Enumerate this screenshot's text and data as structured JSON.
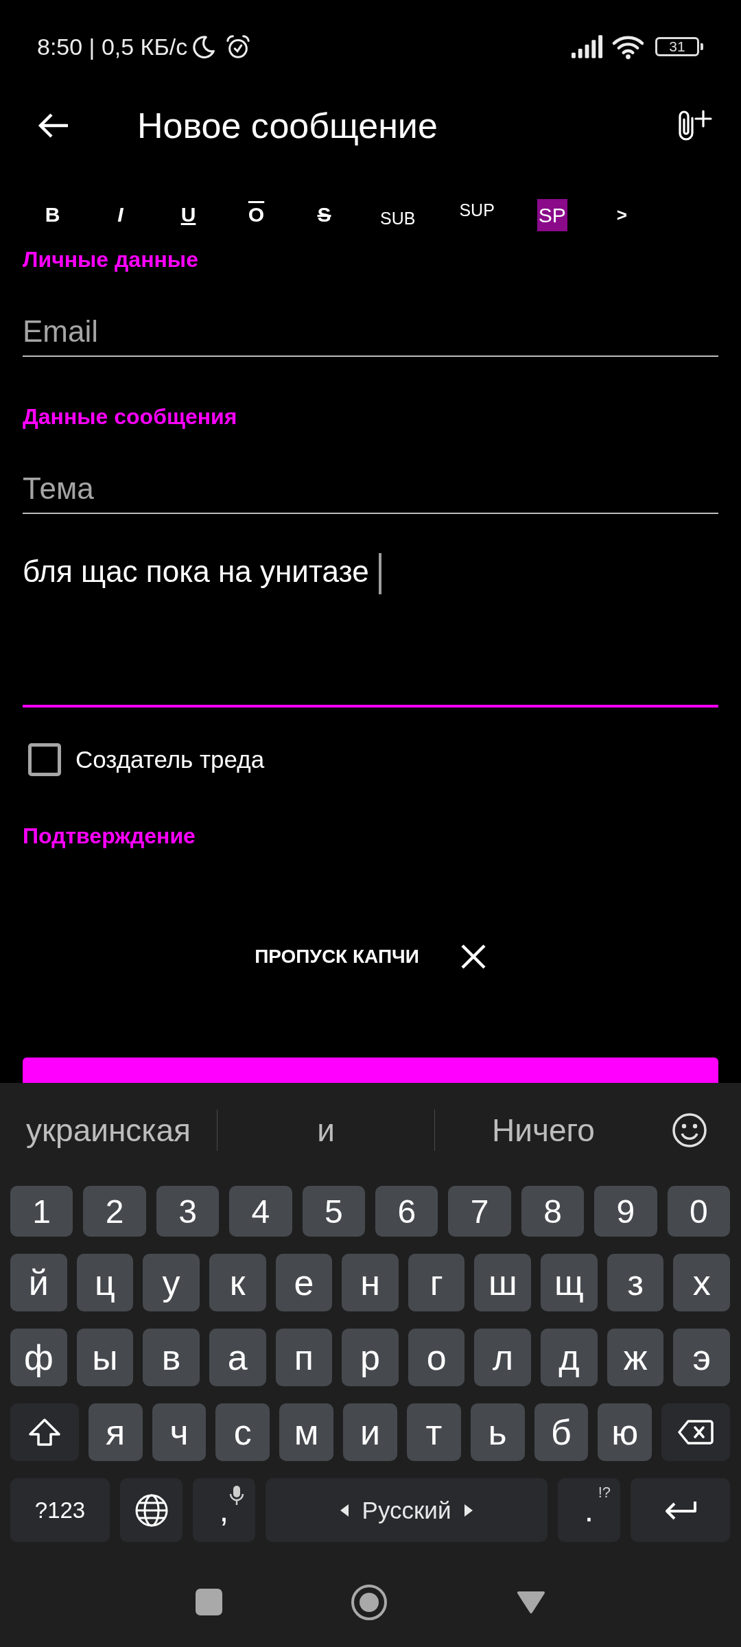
{
  "status_bar": {
    "text": "8:50 | 0,5 КБ/с",
    "battery": "31"
  },
  "header": {
    "title": "Новое сообщение"
  },
  "format_toolbar": [
    {
      "label": "B",
      "kind": "bold"
    },
    {
      "label": "I",
      "kind": "italic"
    },
    {
      "label": "U",
      "kind": "underline"
    },
    {
      "label": "O",
      "kind": "overline"
    },
    {
      "label": "S",
      "kind": "strike"
    },
    {
      "label": "SUB",
      "kind": "sub"
    },
    {
      "label": "SUP",
      "kind": "sup"
    },
    {
      "label": "SP",
      "kind": "spoiler"
    },
    {
      "label": ">",
      "kind": "more"
    }
  ],
  "sections": [
    {
      "title": "Личные данные",
      "fields": [
        {
          "kind": "line",
          "placeholder": "Email",
          "focused": false
        }
      ]
    },
    {
      "title": "Данные сообщения",
      "fields": [
        {
          "kind": "line",
          "placeholder": "Тема",
          "focused": false
        },
        {
          "kind": "multiline",
          "value": "бля щас пока на унитазе",
          "focused": true
        }
      ]
    }
  ],
  "thread_creator": {
    "label": "Создатель треда",
    "checked": false
  },
  "confirmation": {
    "title": "Подтверждение",
    "captcha_skip": "ПРОПУСК КАПЧИ"
  },
  "keyboard": {
    "suggestions": [
      "украинская",
      "и",
      "Ничего"
    ],
    "key_rows": [
      {
        "keys": [
          {
            "kind": "char",
            "label": "1"
          },
          {
            "kind": "char",
            "label": "2"
          },
          {
            "kind": "char",
            "label": "3"
          },
          {
            "kind": "char",
            "label": "4"
          },
          {
            "kind": "char",
            "label": "5"
          },
          {
            "kind": "char",
            "label": "6"
          },
          {
            "kind": "char",
            "label": "7"
          },
          {
            "kind": "char",
            "label": "8"
          },
          {
            "kind": "char",
            "label": "9"
          },
          {
            "kind": "char",
            "label": "0"
          }
        ]
      },
      {
        "keys": [
          {
            "kind": "char",
            "label": "й"
          },
          {
            "kind": "char",
            "label": "ц"
          },
          {
            "kind": "char",
            "label": "у"
          },
          {
            "kind": "char",
            "label": "к"
          },
          {
            "kind": "char",
            "label": "е"
          },
          {
            "kind": "char",
            "label": "н"
          },
          {
            "kind": "char",
            "label": "г"
          },
          {
            "kind": "char",
            "label": "ш"
          },
          {
            "kind": "char",
            "label": "щ"
          },
          {
            "kind": "char",
            "label": "з"
          },
          {
            "kind": "char",
            "label": "х"
          }
        ]
      },
      {
        "keys": [
          {
            "kind": "char",
            "label": "ф"
          },
          {
            "kind": "char",
            "label": "ы"
          },
          {
            "kind": "char",
            "label": "в"
          },
          {
            "kind": "char",
            "label": "а"
          },
          {
            "kind": "char",
            "label": "п"
          },
          {
            "kind": "char",
            "label": "р"
          },
          {
            "kind": "char",
            "label": "о"
          },
          {
            "kind": "char",
            "label": "л"
          },
          {
            "kind": "char",
            "label": "д"
          },
          {
            "kind": "char",
            "label": "ж"
          },
          {
            "kind": "char",
            "label": "э"
          }
        ]
      },
      {
        "keys": [
          {
            "kind": "shift"
          },
          {
            "kind": "char",
            "label": "я"
          },
          {
            "kind": "char",
            "label": "ч"
          },
          {
            "kind": "char",
            "label": "с"
          },
          {
            "kind": "char",
            "label": "м"
          },
          {
            "kind": "char",
            "label": "и"
          },
          {
            "kind": "char",
            "label": "т"
          },
          {
            "kind": "char",
            "label": "ь"
          },
          {
            "kind": "char",
            "label": "б"
          },
          {
            "kind": "char",
            "label": "ю"
          },
          {
            "kind": "backspace"
          }
        ]
      },
      {
        "keys": [
          {
            "kind": "mode",
            "label": "?123"
          },
          {
            "kind": "globe"
          },
          {
            "kind": "comma",
            "label": ","
          },
          {
            "kind": "space",
            "label": "Русский"
          },
          {
            "kind": "period",
            "label": ".",
            "hint": "!?"
          },
          {
            "kind": "enter"
          }
        ]
      }
    ]
  }
}
